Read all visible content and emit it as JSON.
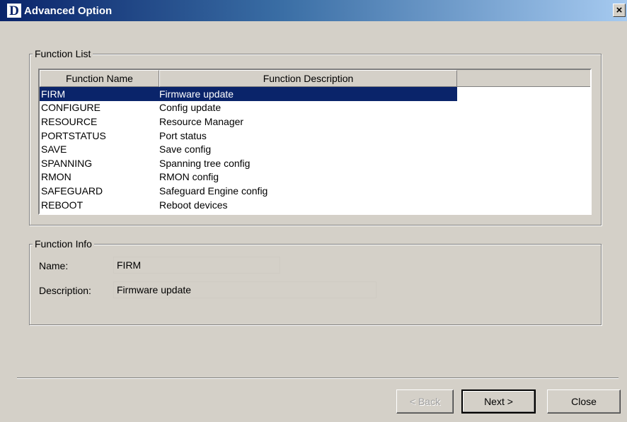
{
  "window": {
    "title": "Advanced Option",
    "logo_letter": "D",
    "close_glyph": "×"
  },
  "function_list": {
    "legend": "Function List",
    "columns": {
      "name": "Function Name",
      "description": "Function Description"
    },
    "rows": [
      {
        "name": "FIRM",
        "description": "Firmware update"
      },
      {
        "name": "CONFIGURE",
        "description": "Config update"
      },
      {
        "name": "RESOURCE",
        "description": "Resource Manager"
      },
      {
        "name": "PORTSTATUS",
        "description": "Port status"
      },
      {
        "name": "SAVE",
        "description": "Save config"
      },
      {
        "name": "SPANNING",
        "description": "Spanning tree config"
      },
      {
        "name": "RMON",
        "description": "RMON config"
      },
      {
        "name": "SAFEGUARD",
        "description": "Safeguard Engine config"
      },
      {
        "name": "REBOOT",
        "description": "Reboot devices"
      }
    ],
    "selected_index": 0
  },
  "function_info": {
    "legend": "Function Info",
    "name_label": "Name:",
    "name_value": "FIRM",
    "description_label": "Description:",
    "description_value": "Firmware update"
  },
  "buttons": {
    "back_label": "< Back",
    "next_label": "Next >",
    "close_label": "Close"
  },
  "colors": {
    "selection": "#0a246a",
    "dialog_bg": "#d4d0c8"
  }
}
